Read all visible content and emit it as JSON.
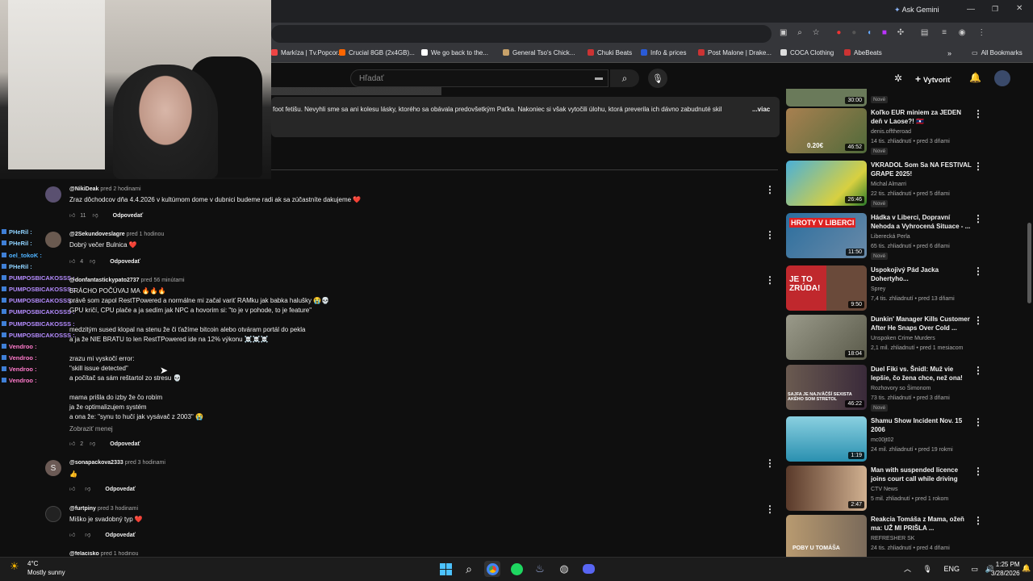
{
  "browser": {
    "gemini_label": "Ask Gemini",
    "bookmarks": [
      {
        "label": "Markíza | Tv.Popcor...",
        "color": "#e44"
      },
      {
        "label": "Crucial 8GB (2x4GB)...",
        "color": "#f60"
      },
      {
        "label": "We go back to the...",
        "color": "#fff"
      },
      {
        "label": "General Tso's Chick...",
        "color": "#c8a26a"
      },
      {
        "label": "Chuki Beats",
        "color": "#c33"
      },
      {
        "label": "Info & prices",
        "color": "#2a5bd7"
      },
      {
        "label": "Post Malone | Drake...",
        "color": "#c33"
      },
      {
        "label": "COCA Clothing",
        "color": "#ddd"
      },
      {
        "label": "AbeBeats",
        "color": "#c33"
      }
    ],
    "all_bookmarks": "All Bookmarks"
  },
  "youtube": {
    "search_placeholder": "Hľadať",
    "create_label": "Vytvoriť",
    "description": "foot fetišu. Nevyhli sme sa ani kolesu lásky, ktorého sa obávala predovšetkým Paťka. Nakoniec si však vytočili úlohu, ktorá preverila ich dávno zabudnuté skilly.",
    "more_label": "...viac"
  },
  "comments": [
    {
      "user": "@NikiDeak",
      "time": "pred 2 hodinami",
      "text": "Zraz dôchodcov dňa 4.4.2026 v kultúrnom dome v dubnici budeme radi ak sa zúčastníte dakujeme ❤️",
      "likes": "11",
      "reply": "Odpovedať"
    },
    {
      "user": "@2Sekundoveslagre",
      "time": "pred 1 hodinou",
      "text": "Dobrý večer Bulnica ❤️",
      "likes": "4",
      "reply": "Odpovedať"
    },
    {
      "user": "@donfantastickypato2737",
      "time": "pred 56 minútami",
      "text": "BRÁCHO POČÚVAJ MA 🔥🔥🔥\nprávě som zapol RestTPowered a normálne mi začal variť RAMku jak babka halušky 😭💀\nGPU kričí, CPU plače a ja sedím jak NPC a hovorim si: \"to je v pohode, to je feature\"\n\nmedzitým sused klopal na stenu že či ťažíme bitcoin alebo otváram portál do pekla\na ja že NIE BRATU to len RestTPowered ide na 12% výkonu ☠️☠️☠️\n\nzrazu mi vyskočí error:\n\"skill issue detected\"\na počítač sa sám reštartol zo stresu 💀\n\nmama prišla do izby že čo robím\nja že optimalizujem systém\na ona že: \"synu to hučí jak vysávač z 2003\" 😭",
      "show_less": "Zobraziť menej",
      "likes": "2",
      "reply": "Odpovedať"
    },
    {
      "user": "@sonapackova2333",
      "time": "pred 3 hodinami",
      "text": "👍",
      "likes": "",
      "reply": "Odpovedať",
      "avatar_letter": "S"
    },
    {
      "user": "@furtpiny",
      "time": "pred 3 hodinami",
      "text": "Miško je svadobný typ ❤️",
      "likes": "",
      "reply": "Odpovedať"
    },
    {
      "user": "@felacisko",
      "time": "pred 1 hodinou"
    }
  ],
  "chat_overlay": [
    {
      "name": "PHeRil :",
      "color": "#8fd3ff"
    },
    {
      "name": "PHeRil :",
      "color": "#8fd3ff"
    },
    {
      "name": "oel_tokoK :",
      "color": "#4fb3ff"
    },
    {
      "name": "PHeRil :",
      "color": "#8fd3ff"
    },
    {
      "name": "PUMPOSBICAKOSSS :",
      "color": "#b58cff"
    },
    {
      "name": "PUMPOSBICAKOSSS :",
      "color": "#b58cff"
    },
    {
      "name": "PUMPOSBICAKOSSS :",
      "color": "#b58cff"
    },
    {
      "name": "PUMPOSBICAKOSSS :",
      "color": "#b58cff"
    },
    {
      "name": "PUMPOSBICAKOSSS :",
      "color": "#b58cff"
    },
    {
      "name": "PUMPOSBICAKOSSS :",
      "color": "#b58cff"
    },
    {
      "name": "Vendroo :",
      "color": "#ff7acb"
    },
    {
      "name": "Vendroo :",
      "color": "#ff7acb"
    },
    {
      "name": "Vendroo :",
      "color": "#ff7acb"
    },
    {
      "name": "Vendroo :",
      "color": "#ff7acb"
    }
  ],
  "recommendations": [
    {
      "title": "",
      "channel": "",
      "meta": "",
      "badge": "Nové",
      "duration": "30:00",
      "thumb": "#6a7a5a"
    },
    {
      "title": "Koľko EUR miniem za JEDEN deň v Laose?! 🇱🇦",
      "channel": "denis.offtheroad",
      "meta": "14 tis. zhliadnutí • pred 3 dňami",
      "badge": "Nové",
      "duration": "46:52",
      "thumb": "#8a6a3a",
      "overlay": "0.20€"
    },
    {
      "title": "VKRADOL Som Sa NA FESTIVAL GRAPE 2025!",
      "channel": "Michal Almarri",
      "meta": "22 tis. zhliadnutí • pred 5 dňami",
      "badge": "Nové",
      "duration": "26:46",
      "thumb": "#3aa0c8"
    },
    {
      "title": "Hádka v Liberci, Dopravní Nehoda a Vyhrocená Situace - ...",
      "channel": "Liberecká Perla",
      "meta": "65 tis. zhliadnutí • pred 6 dňami",
      "badge": "Nové",
      "duration": "11:50",
      "thumb": "#2b6e9e",
      "overlay": "HROTY V LIBERCI"
    },
    {
      "title": "Uspokojivý Pád Jacka Dohertyho...",
      "channel": "Sprey",
      "meta": "7,4 tis. zhliadnutí • pred 13 dňami",
      "badge": "",
      "duration": "9:50",
      "thumb": "#c0282d",
      "overlay": "JE TO ZRÚDA!"
    },
    {
      "title": "Dunkin' Manager Kills Customer After He Snaps Over Cold ...",
      "channel": "Unspoken Crime Murders",
      "meta": "2,1 mil. zhliadnutí • pred 1 mesiacom",
      "badge": "",
      "duration": "18:04",
      "thumb": "#8a8a7a"
    },
    {
      "title": "Duel Fiki vs. Šnidl: Muž vie lepšie, čo žena chce, než ona!",
      "channel": "Rozhovory so Šimonom",
      "meta": "73 tis. zhliadnutí • pred 3 dňami",
      "badge": "Nové",
      "duration": "46:22",
      "thumb": "#4a3a4a",
      "overlay": "SAJFA JE NAJVÄČŠÍ SEXISTA AKÉHO SOM STRETOL"
    },
    {
      "title": "Shamu Show Incident Nov. 15 2006",
      "channel": "mc00jt02",
      "meta": "24 mil. zhliadnutí • pred 19 rokmi",
      "badge": "",
      "duration": "1:19",
      "thumb": "#3aa8c0"
    },
    {
      "title": "Man with suspended licence joins court call while driving",
      "channel": "CTV News",
      "meta": "5 mil. zhliadnutí • pred 1 rokom",
      "badge": "",
      "duration": "2:47",
      "thumb": "#c8a070"
    },
    {
      "title": "Reakcia Tomáša z Mama, ožeň ma: UŽ MI PRIŠLA ...",
      "channel": "REFRESHER SK",
      "meta": "24 tis. zhliadnutí • pred 4 dňami",
      "badge": "",
      "duration": "",
      "thumb": "#b89a70",
      "overlay": "POBY U TOMÁŠA"
    }
  ],
  "taskbar": {
    "temperature": "4°C",
    "weather": "Mostly sunny",
    "lang": "ENG",
    "time": "1:25 PM",
    "date": "3/28/2026"
  }
}
